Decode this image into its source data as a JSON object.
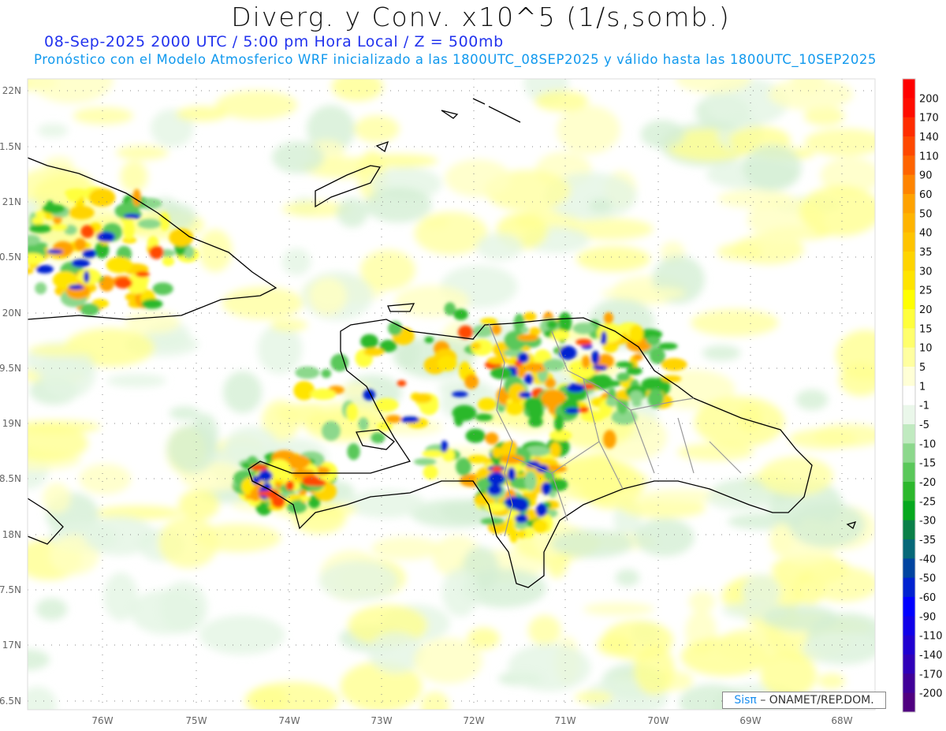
{
  "header": {
    "title": "Diverg. y Conv. x10^5 (1/s,somb.)",
    "subtitle": "08-Sep-2025  2000 UTC / 5:00 pm Hora Local / Z = 500mb",
    "description": "Pronóstico con el Modelo Atmosferico WRF inicializado a las 1800UTC_08SEP2025 y válido hasta las  1800UTC_10SEP2025"
  },
  "map": {
    "lon_labels": [
      "76W",
      "75W",
      "74W",
      "73W",
      "72W",
      "71W",
      "70W",
      "69W",
      "68W"
    ],
    "lat_labels": [
      "22N",
      "1.5N",
      "21N",
      "0.5N",
      "20N",
      "9.5N",
      "19N",
      "8.5N",
      "18N",
      "7.5N",
      "17N",
      "6.5N"
    ]
  },
  "colorbar": {
    "labels": [
      "200",
      "170",
      "140",
      "110",
      "90",
      "60",
      "50",
      "40",
      "35",
      "30",
      "25",
      "20",
      "15",
      "10",
      "5",
      "1",
      "-1",
      "-5",
      "-10",
      "-15",
      "-20",
      "-25",
      "-30",
      "-35",
      "-40",
      "-50",
      "-60",
      "-90",
      "-110",
      "-140",
      "-170",
      "-200"
    ],
    "colors": [
      "#ff0000",
      "#ff0c00",
      "#ff2c00",
      "#ff4800",
      "#ff6400",
      "#ff8400",
      "#ffa200",
      "#ffb400",
      "#ffc400",
      "#ffd400",
      "#ffe400",
      "#ffff00",
      "#ffff3c",
      "#ffff6c",
      "#ffffa0",
      "#ffffd6",
      "#ffffff",
      "#eaf7ea",
      "#c0eac0",
      "#8cd88c",
      "#5ac85a",
      "#2cb82c",
      "#06a81e",
      "#0a8048",
      "#066878",
      "#0044a0",
      "#0022d0",
      "#0000ff",
      "#1000e8",
      "#2000d0",
      "#3000b8",
      "#400098",
      "#500080"
    ]
  },
  "credit": {
    "brand": "Sisπ",
    "text": "– ONAMET/REP.DOM."
  }
}
